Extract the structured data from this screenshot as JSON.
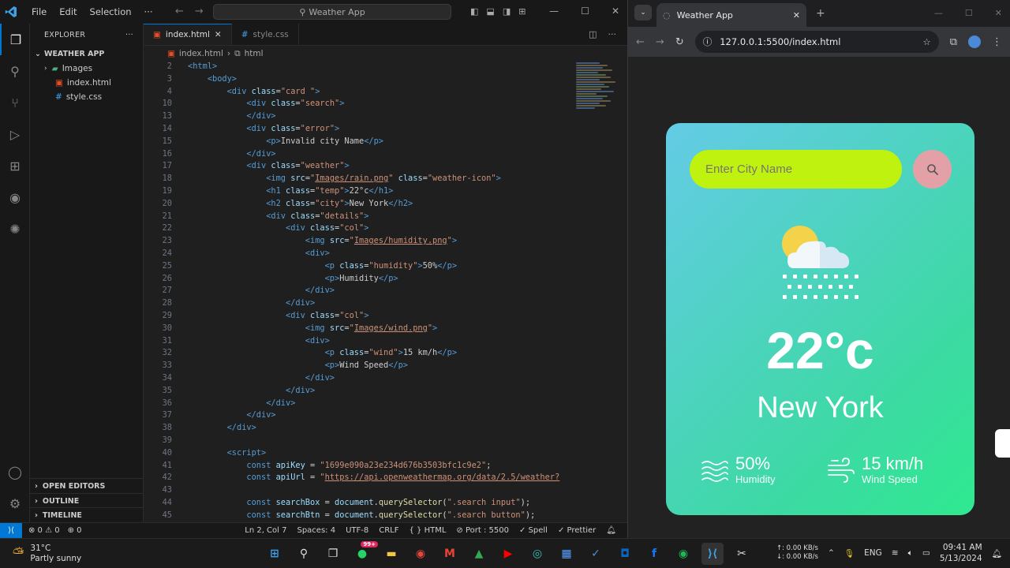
{
  "vscode": {
    "menu": [
      "File",
      "Edit",
      "Selection",
      "···"
    ],
    "command_center": "Weather App",
    "explorer_title": "EXPLORER",
    "folder": "WEATHER APP",
    "files": [
      {
        "name": "Images",
        "kind": "folder"
      },
      {
        "name": "index.html",
        "kind": "html"
      },
      {
        "name": "style.css",
        "kind": "css"
      }
    ],
    "sections": [
      "OPEN EDITORS",
      "OUTLINE",
      "TIMELINE"
    ],
    "tabs": [
      {
        "label": "index.html",
        "active": true
      },
      {
        "label": "style.css",
        "active": false
      }
    ],
    "breadcrumb": [
      "index.html",
      "html"
    ],
    "code_lines": [
      {
        "n": "2",
        "html": "<span class='t'>&lt;html&gt;</span>"
      },
      {
        "n": "3",
        "html": "    <span class='t'>&lt;body&gt;</span>"
      },
      {
        "n": "4",
        "html": "        <span class='t'>&lt;div</span> <span class='a'>class</span><span class='o'>=</span><span class='s'>\"card \"</span><span class='t'>&gt;</span>"
      },
      {
        "n": "10",
        "html": "            <span class='t'>&lt;div</span> <span class='a'>class</span><span class='o'>=</span><span class='s'>\"search\"</span><span class='t'>&gt;</span>"
      },
      {
        "n": "13",
        "html": "            <span class='t'>&lt;/div&gt;</span>"
      },
      {
        "n": "14",
        "html": "            <span class='t'>&lt;div</span> <span class='a'>class</span><span class='o'>=</span><span class='s'>\"error\"</span><span class='t'>&gt;</span>"
      },
      {
        "n": "15",
        "html": "                <span class='t'>&lt;p&gt;</span>Invalid city Name<span class='t'>&lt;/p&gt;</span>"
      },
      {
        "n": "16",
        "html": "            <span class='t'>&lt;/div&gt;</span>"
      },
      {
        "n": "17",
        "html": "            <span class='t'>&lt;div</span> <span class='a'>class</span><span class='o'>=</span><span class='s'>\"weather\"</span><span class='t'>&gt;</span>"
      },
      {
        "n": "18",
        "html": "                <span class='t'>&lt;img</span> <span class='a'>src</span><span class='o'>=</span><span class='s'>\"<u>Images/rain.png</u>\"</span> <span class='a'>class</span><span class='o'>=</span><span class='s'>\"weather-icon\"</span><span class='t'>&gt;</span>"
      },
      {
        "n": "19",
        "html": "                <span class='t'>&lt;h1</span> <span class='a'>class</span><span class='o'>=</span><span class='s'>\"temp\"</span><span class='t'>&gt;</span>22°c<span class='t'>&lt;/h1&gt;</span>"
      },
      {
        "n": "20",
        "html": "                <span class='t'>&lt;h2</span> <span class='a'>class</span><span class='o'>=</span><span class='s'>\"city\"</span><span class='t'>&gt;</span>New York<span class='t'>&lt;/h2&gt;</span>"
      },
      {
        "n": "21",
        "html": "                <span class='t'>&lt;div</span> <span class='a'>class</span><span class='o'>=</span><span class='s'>\"details\"</span><span class='t'>&gt;</span>"
      },
      {
        "n": "22",
        "html": "                    <span class='t'>&lt;div</span> <span class='a'>class</span><span class='o'>=</span><span class='s'>\"col\"</span><span class='t'>&gt;</span>"
      },
      {
        "n": "23",
        "html": "                        <span class='t'>&lt;img</span> <span class='a'>src</span><span class='o'>=</span><span class='s'>\"<u>Images/humidity.png</u>\"</span><span class='t'>&gt;</span>"
      },
      {
        "n": "24",
        "html": "                        <span class='t'>&lt;div&gt;</span>"
      },
      {
        "n": "25",
        "html": "                            <span class='t'>&lt;p</span> <span class='a'>class</span><span class='o'>=</span><span class='s'>\"humidity\"</span><span class='t'>&gt;</span>50%<span class='t'>&lt;/p&gt;</span>"
      },
      {
        "n": "26",
        "html": "                            <span class='t'>&lt;p&gt;</span>Humidity<span class='t'>&lt;/p&gt;</span>"
      },
      {
        "n": "27",
        "html": "                        <span class='t'>&lt;/div&gt;</span>"
      },
      {
        "n": "28",
        "html": "                    <span class='t'>&lt;/div&gt;</span>"
      },
      {
        "n": "29",
        "html": "                    <span class='t'>&lt;div</span> <span class='a'>class</span><span class='o'>=</span><span class='s'>\"col\"</span><span class='t'>&gt;</span>"
      },
      {
        "n": "30",
        "html": "                        <span class='t'>&lt;img</span> <span class='a'>src</span><span class='o'>=</span><span class='s'>\"<u>Images/wind.png</u>\"</span><span class='t'>&gt;</span>"
      },
      {
        "n": "31",
        "html": "                        <span class='t'>&lt;div&gt;</span>"
      },
      {
        "n": "32",
        "html": "                            <span class='t'>&lt;p</span> <span class='a'>class</span><span class='o'>=</span><span class='s'>\"wind\"</span><span class='t'>&gt;</span>15 km/h<span class='t'>&lt;/p&gt;</span>"
      },
      {
        "n": "33",
        "html": "                            <span class='t'>&lt;p&gt;</span>Wind Speed<span class='t'>&lt;/p&gt;</span>"
      },
      {
        "n": "34",
        "html": "                        <span class='t'>&lt;/div&gt;</span>"
      },
      {
        "n": "35",
        "html": "                    <span class='t'>&lt;/div&gt;</span>"
      },
      {
        "n": "36",
        "html": "                <span class='t'>&lt;/div&gt;</span>"
      },
      {
        "n": "37",
        "html": "            <span class='t'>&lt;/div&gt;</span>"
      },
      {
        "n": "38",
        "html": "        <span class='t'>&lt;/div&gt;</span>"
      },
      {
        "n": "39",
        "html": ""
      },
      {
        "n": "40",
        "html": "        <span class='t'>&lt;script&gt;</span>"
      },
      {
        "n": "41",
        "html": "            <span class='k'>const</span> <span class='v'>apiKey</span> <span class='o'>=</span> <span class='s'>\"1699e090a23e234d676b3503bfc1c9e2\"</span><span class='o'>;</span>"
      },
      {
        "n": "42",
        "html": "            <span class='k'>const</span> <span class='v'>apiUrl</span> <span class='o'>=</span> <span class='s'>\"<u>https://api.openweathermap.org/data/2.5/weather?</u></span>"
      },
      {
        "n": "43",
        "html": ""
      },
      {
        "n": "44",
        "html": "            <span class='k'>const</span> <span class='v'>searchBox</span> <span class='o'>=</span> <span class='v'>document</span><span class='o'>.</span><span class='f'>querySelector</span><span class='o'>(</span><span class='s'>\".search input\"</span><span class='o'>);</span>"
      },
      {
        "n": "45",
        "html": "            <span class='k'>const</span> <span class='v'>searchBtn</span> <span class='o'>=</span> <span class='v'>document</span><span class='o'>.</span><span class='f'>querySelector</span><span class='o'>(</span><span class='s'>\".search button\"</span><span class='o'>);</span>"
      }
    ],
    "status": {
      "problems": "⊗ 0 ⚠ 0",
      "ports": "⊕ 0",
      "position": "Ln 2, Col 7",
      "spaces": "Spaces: 4",
      "encoding": "UTF-8",
      "eol": "CRLF",
      "language": "{ } HTML",
      "port": "⊘ Port : 5500",
      "spell": "✓ Spell",
      "prettier": "✓ Prettier"
    }
  },
  "browser": {
    "tab_title": "Weather App",
    "url": "127.0.0.1:5500/index.html",
    "app": {
      "placeholder": "Enter City Name",
      "temp": "22°c",
      "city": "New York",
      "humidity_value": "50%",
      "humidity_label": "Humidity",
      "wind_value": "15 km/h",
      "wind_label": "Wind Speed"
    }
  },
  "taskbar": {
    "weather_temp": "31°C",
    "weather_desc": "Partly sunny",
    "net_up": "↑: 0.00 KB/s",
    "net_down": "↓: 0.00 KB/s",
    "lang": "ENG",
    "time": "09:41 AM",
    "date": "5/13/2024",
    "badge": "99+"
  },
  "colors": {
    "vscode_accent": "#0078d4",
    "card_gradient_start": "#64cbe6",
    "card_gradient_end": "#2ee98f",
    "search_input": "#c0f20f",
    "search_button": "#e3a1a7"
  }
}
